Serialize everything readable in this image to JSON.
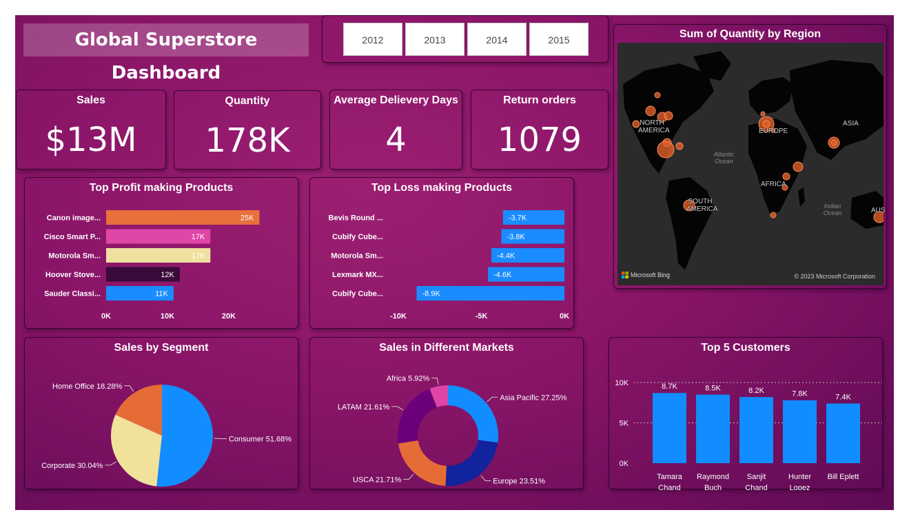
{
  "dashboard": {
    "title": "Global Superstore Dashboard"
  },
  "year_slicer": {
    "years": [
      "2012",
      "2013",
      "2014",
      "2015"
    ]
  },
  "kpis": [
    {
      "label": "Sales",
      "value": "$13M"
    },
    {
      "label": "Quantity",
      "value": "178K"
    },
    {
      "label": "Average Delievery Days",
      "value": "4"
    },
    {
      "label": "Return orders",
      "value": "1079"
    }
  ],
  "map": {
    "title": "Sum of Quantity by Region",
    "labels": [
      "NORTH AMERICA",
      "EUROPE",
      "ASIA",
      "AFRICA",
      "SOUTH AMERICA",
      "AUS"
    ],
    "oceans": [
      "Atlantic Ocean",
      "Indian Ocean"
    ],
    "bing_text": "Microsoft Bing",
    "copyright": "© 2023 Microsoft Corporation"
  },
  "chart_data": [
    {
      "type": "bar",
      "orientation": "horizontal",
      "title": "Top Profit making Products",
      "categories": [
        "Canon image...",
        "Cisco Smart P...",
        "Motorola Sm...",
        "Hoover Stove...",
        "Sauder Classi..."
      ],
      "values": [
        25000,
        17000,
        17000,
        12000,
        11000
      ],
      "data_labels": [
        "25K",
        "17K",
        "17K",
        "12K",
        "11K"
      ],
      "colors": [
        "#e8703a",
        "#e045a8",
        "#f0e0a0",
        "#3a0a3a",
        "#1a8cff"
      ],
      "xlim": [
        0,
        25000
      ],
      "ticks": [
        0,
        10000,
        20000
      ],
      "tick_labels": [
        "0K",
        "10K",
        "20K"
      ]
    },
    {
      "type": "bar",
      "orientation": "horizontal",
      "title": "Top Loss making Products",
      "categories": [
        "Bevis Round ...",
        "Cubify Cube...",
        "Motorola Sm...",
        "Lexmark MX...",
        "Cubify Cube..."
      ],
      "values": [
        -3700,
        -3800,
        -4400,
        -4600,
        -8900
      ],
      "data_labels": [
        "-3.7K",
        "-3.8K",
        "-4.4K",
        "-4.6K",
        "-8.9K"
      ],
      "color": "#1a8cff",
      "xlim": [
        -10000,
        0
      ],
      "ticks": [
        -10000,
        -5000,
        0
      ],
      "tick_labels": [
        "-10K",
        "-5K",
        "0K"
      ]
    },
    {
      "type": "pie",
      "title": "Sales by Segment",
      "slices": [
        {
          "label": "Consumer",
          "value": 51.68,
          "display": "Consumer 51.68%",
          "color": "#118dff"
        },
        {
          "label": "Corporate",
          "value": 30.04,
          "display": "Corporate 30.04%",
          "color": "#f0e29b"
        },
        {
          "label": "Home Office",
          "value": 18.28,
          "display": "Home Office 18.28%",
          "color": "#e66c37"
        }
      ]
    },
    {
      "type": "pie",
      "donut": true,
      "title": "Sales in Different Markets",
      "slices": [
        {
          "label": "Asia Pacific",
          "value": 27.25,
          "display": "Asia Pacific 27.25%",
          "color": "#118dff"
        },
        {
          "label": "Europe",
          "value": 23.51,
          "display": "Europe 23.51%",
          "color": "#12239e"
        },
        {
          "label": "USCA",
          "value": 21.71,
          "display": "USCA 21.71%",
          "color": "#e66c37"
        },
        {
          "label": "LATAM",
          "value": 21.61,
          "display": "LATAM 21.61%",
          "color": "#6b007b"
        },
        {
          "label": "Africa",
          "value": 5.92,
          "display": "Africa 5.92%",
          "color": "#e044a7"
        }
      ]
    },
    {
      "type": "bar",
      "title": "Top 5 Customers",
      "categories": [
        [
          "Tamara",
          "Chand"
        ],
        [
          "Raymond",
          "Buch"
        ],
        [
          "Sanjit",
          "Chand"
        ],
        [
          "Hunter",
          "Lopez"
        ],
        [
          "Bill Eplett"
        ]
      ],
      "values": [
        8700,
        8500,
        8200,
        7800,
        7400
      ],
      "data_labels": [
        "8.7K",
        "8.5K",
        "8.2K",
        "7.8K",
        "7.4K"
      ],
      "color": "#118dff",
      "ylim": [
        0,
        10000
      ],
      "ticks": [
        0,
        5000,
        10000
      ],
      "tick_labels": [
        "0K",
        "5K",
        "10K"
      ],
      "grid": true
    }
  ]
}
